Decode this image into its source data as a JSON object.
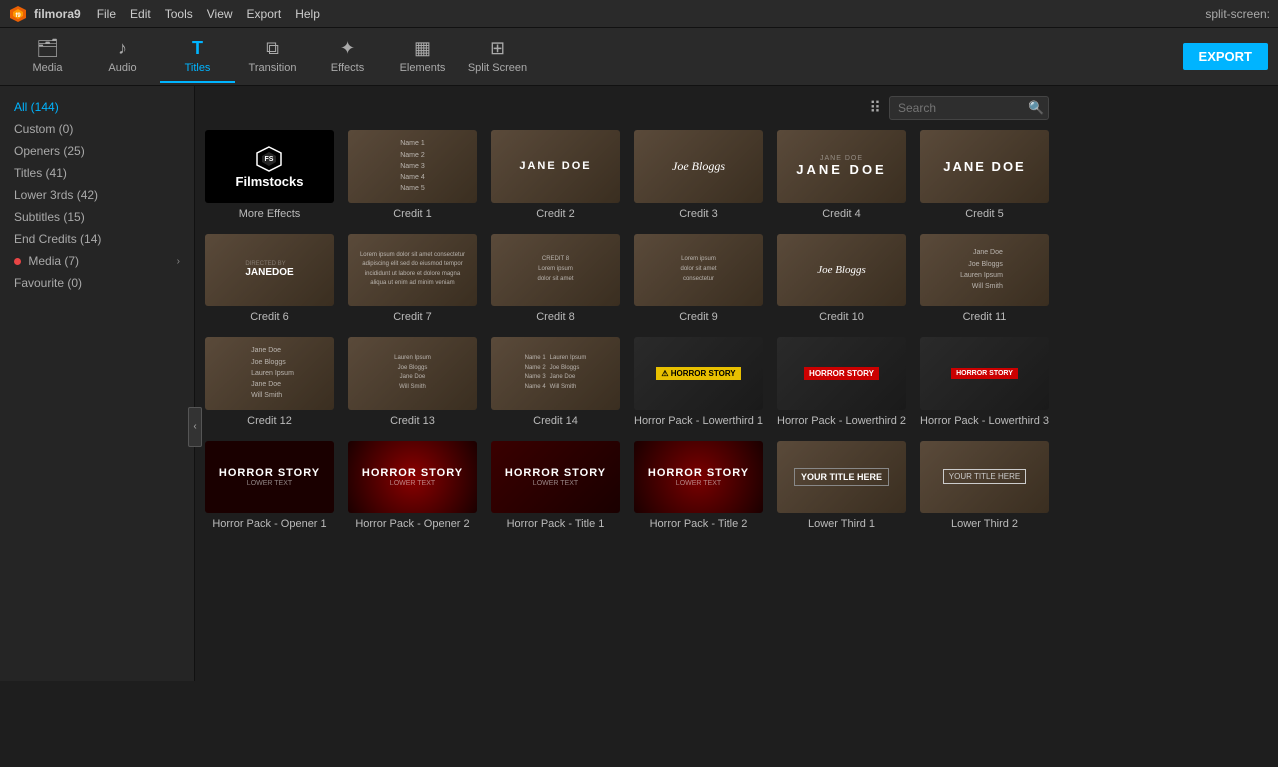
{
  "app": {
    "name": "filmora9",
    "split_screen_label": "split-screen:"
  },
  "menubar": {
    "items": [
      "File",
      "Edit",
      "Tools",
      "View",
      "Export",
      "Help"
    ]
  },
  "toolbar": {
    "items": [
      {
        "label": "Media",
        "icon": "🗂",
        "active": false
      },
      {
        "label": "Audio",
        "icon": "♪",
        "active": false
      },
      {
        "label": "Titles",
        "icon": "T",
        "active": true
      },
      {
        "label": "Transition",
        "icon": "⧉",
        "active": false
      },
      {
        "label": "Effects",
        "icon": "✦",
        "active": false
      },
      {
        "label": "Elements",
        "icon": "▦",
        "active": false
      },
      {
        "label": "Split Screen",
        "icon": "⊞",
        "active": false
      }
    ],
    "export_label": "EXPORT"
  },
  "sidebar": {
    "items": [
      {
        "label": "All (144)",
        "active": true,
        "dot": false
      },
      {
        "label": "Custom (0)",
        "active": false,
        "dot": false
      },
      {
        "label": "Openers (25)",
        "active": false,
        "dot": false
      },
      {
        "label": "Titles (41)",
        "active": false,
        "dot": false
      },
      {
        "label": "Lower 3rds (42)",
        "active": false,
        "dot": false
      },
      {
        "label": "Subtitles (15)",
        "active": false,
        "dot": false
      },
      {
        "label": "End Credits (14)",
        "active": false,
        "dot": false
      },
      {
        "label": "Media (7)",
        "active": false,
        "dot": true
      },
      {
        "label": "Favourite (0)",
        "active": false,
        "dot": false
      }
    ]
  },
  "search": {
    "placeholder": "Search"
  },
  "grid": {
    "items": [
      {
        "label": "More Effects",
        "type": "filmstock"
      },
      {
        "label": "Credit 1",
        "type": "credit-list"
      },
      {
        "label": "Credit 2",
        "type": "jane-doe-center"
      },
      {
        "label": "Credit 3",
        "type": "joe-bloggs-script"
      },
      {
        "label": "Credit 4",
        "type": "jane-doe-caps"
      },
      {
        "label": "Credit 5",
        "type": "jane-doe-caps2"
      },
      {
        "label": "Credit 6",
        "type": "jane-doe-small"
      },
      {
        "label": "Credit 7",
        "type": "credit-list-small"
      },
      {
        "label": "Credit 8",
        "type": "credit-list-sm2"
      },
      {
        "label": "Credit 9",
        "type": "credit-list-sm3"
      },
      {
        "label": "Credit 10",
        "type": "joe-bloggs-serif"
      },
      {
        "label": "Credit 11",
        "type": "credit-list-multi"
      },
      {
        "label": "Credit 12",
        "type": "credit-list-ver"
      },
      {
        "label": "Credit 13",
        "type": "credit-list-ver2"
      },
      {
        "label": "Credit 14",
        "type": "credit-list-ver3"
      },
      {
        "label": "Horror Pack - Lowerthird 1",
        "type": "horror-lower1"
      },
      {
        "label": "Horror Pack - Lowerthird 2",
        "type": "horror-lower2"
      },
      {
        "label": "Horror Pack - Lowerthird 3",
        "type": "horror-lower3"
      },
      {
        "label": "Horror Pack - Opener 1",
        "type": "horror-opener1"
      },
      {
        "label": "Horror Pack - Opener 2",
        "type": "horror-opener2"
      },
      {
        "label": "Horror Pack - Title 1",
        "type": "horror-title1"
      },
      {
        "label": "Horror Pack - Title 2",
        "type": "horror-title2"
      },
      {
        "label": "Lower Third 1",
        "type": "lower-third1"
      },
      {
        "label": "Lower Third 2",
        "type": "lower-third2"
      }
    ]
  }
}
